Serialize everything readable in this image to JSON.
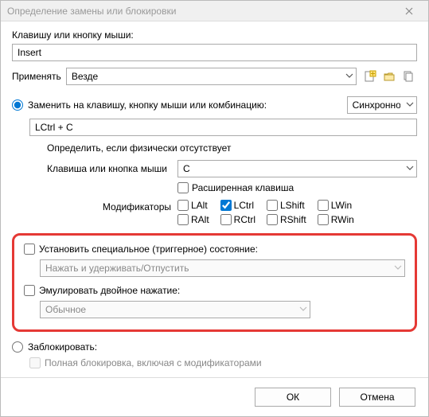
{
  "title": "Определение замены или блокировки",
  "key_label": "Клавишу или кнопку мыши:",
  "key_value": "Insert",
  "apply_label": "Применять",
  "apply_value": "Везде",
  "replace_label": "Заменить на клавишу, кнопку мыши или комбинацию:",
  "sync_value": "Синхронно",
  "combo_value": "LCtrl + C",
  "define_absent_label": "Определить, если физически отсутствует",
  "phys_key_label": "Клавиша или кнопка мыши",
  "phys_key_value": "C",
  "extended_label": "Расширенная клавиша",
  "mod_label": "Модификаторы",
  "mods": {
    "lalt": "LAlt",
    "lctrl": "LCtrl",
    "lshift": "LShift",
    "lwin": "LWin",
    "ralt": "RAlt",
    "rctrl": "RCtrl",
    "rshift": "RShift",
    "rwin": "RWin"
  },
  "trigger_label": "Установить специальное (триггерное) состояние:",
  "trigger_value": "Нажать и удерживать/Отпустить",
  "double_label": "Эмулировать двойное нажатие:",
  "double_value": "Обычное",
  "block_label": "Заблокировать:",
  "fullblock_label": "Полная блокировка, включая с модификаторами",
  "ok": "ОК",
  "cancel": "Отмена"
}
